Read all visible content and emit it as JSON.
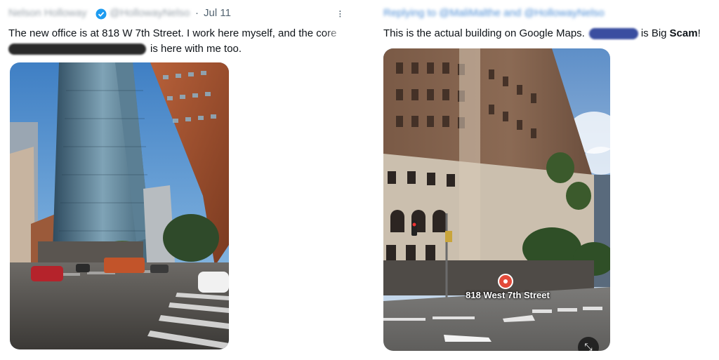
{
  "left_tweet": {
    "author_name": "Nelson Holloway",
    "handle": "@HollowayNelso",
    "separator": "·",
    "date": "Jul 11",
    "text_line1": "The new office is at 818 W 7th Street. I work here myself, and the core",
    "text_line2_after_redaction": "is here with me too."
  },
  "right_tweet": {
    "replying_to": "Replying to @MaliMalthe and @HollowayNelso",
    "text_before": "This is the actual building on Google Maps.",
    "text_mid": "is Big",
    "text_bold": "Scam",
    "text_end": "!",
    "map_pin_label": "818 West 7th Street"
  },
  "colors": {
    "verified": "#1d9bf0",
    "text": "#0f1419",
    "muted": "#536471"
  }
}
